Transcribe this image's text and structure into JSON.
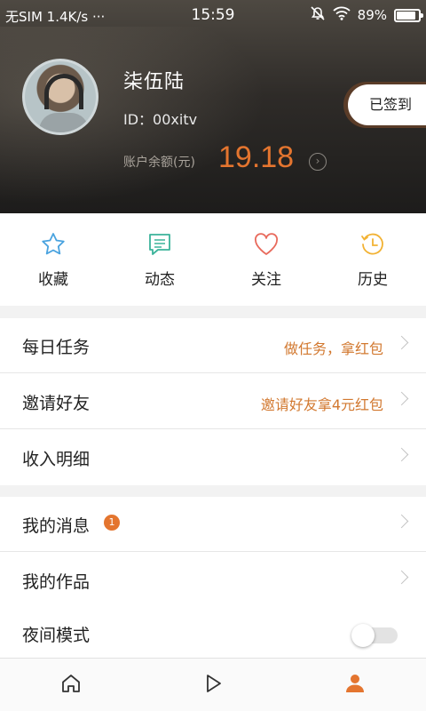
{
  "status_bar": {
    "carrier": "无SIM 1.4K/s ···",
    "time": "15:59",
    "battery": "89%",
    "battery_level": 0.89
  },
  "profile": {
    "username": "柒伍陆",
    "user_id": "ID：00xitv",
    "balance_label": "账户余额(元)",
    "balance_value": "19.18",
    "signin_label": "已签到"
  },
  "quick_actions": [
    {
      "label": "收藏",
      "icon": "star-icon",
      "color": "#4aa3df"
    },
    {
      "label": "动态",
      "icon": "message-icon",
      "color": "#3bb39a"
    },
    {
      "label": "关注",
      "icon": "heart-icon",
      "color": "#e86a5c"
    },
    {
      "label": "历史",
      "icon": "clock-history-icon",
      "color": "#f2b233"
    }
  ],
  "menu_group1": [
    {
      "label": "每日任务",
      "hint": "做任务，拿红包"
    },
    {
      "label": "邀请好友",
      "hint": "邀请好友拿4元红包"
    },
    {
      "label": "收入明细",
      "hint": ""
    }
  ],
  "menu_group2": [
    {
      "label": "我的消息",
      "badge": "1"
    },
    {
      "label": "我的作品"
    },
    {
      "label": "夜间模式",
      "toggle_on": false
    }
  ],
  "bottom_nav": [
    {
      "icon": "home-icon",
      "active": false
    },
    {
      "icon": "play-icon",
      "active": false
    },
    {
      "icon": "profile-icon",
      "active": true
    }
  ],
  "colors": {
    "accent": "#e4752f",
    "hint": "#d2782f",
    "nav_inactive": "#333333"
  }
}
